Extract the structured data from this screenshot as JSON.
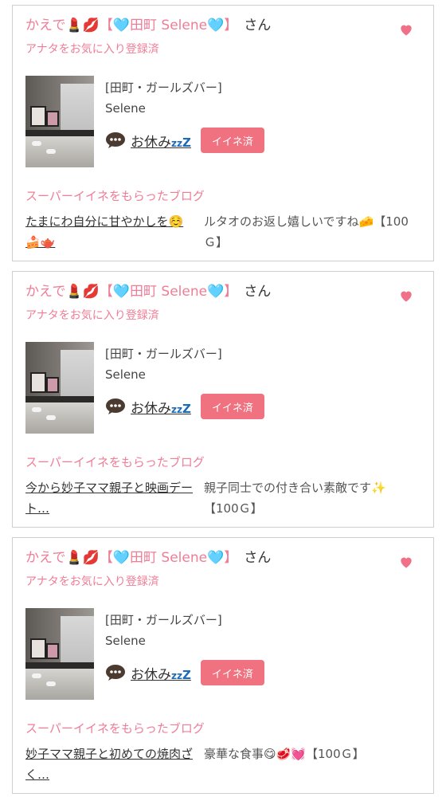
{
  "colors": {
    "accent_pink": "#ef7d96",
    "button_pink": "#f0717f",
    "zzz_blue": "#1c6bb8"
  },
  "cards": [
    {
      "user_prefix": "かえで💄💋",
      "user_tag": "【🩵田町 Selene🩵】",
      "user_suffix": "さん",
      "favorite_status": "アナタをお気に入り登録済",
      "shop": "[田町・ガールズバー]",
      "cast": "Selene",
      "status_text": "お休み",
      "zzz": [
        "z",
        "z",
        "Z"
      ],
      "like_label": "イイネ済",
      "section_label": "スーパーイイネをもらったブログ",
      "blog_title": "たまにわ自分に甘やかしを☺️🍰🫖",
      "comment": "ルタオのお返し嬉しいですね🧀【100Ｇ】"
    },
    {
      "user_prefix": "かえで💄💋",
      "user_tag": "【🩵田町 Selene🩵】",
      "user_suffix": "さん",
      "favorite_status": "アナタをお気に入り登録済",
      "shop": "[田町・ガールズバー]",
      "cast": "Selene",
      "status_text": "お休み",
      "zzz": [
        "z",
        "z",
        "Z"
      ],
      "like_label": "イイネ済",
      "section_label": "スーパーイイネをもらったブログ",
      "blog_title": "今から妙子ママ親子と映画デート…",
      "comment": "親子同士での付き合い素敵です✨【100Ｇ】"
    },
    {
      "user_prefix": "かえで💄💋",
      "user_tag": "【🩵田町 Selene🩵】",
      "user_suffix": "さん",
      "favorite_status": "アナタをお気に入り登録済",
      "shop": "[田町・ガールズバー]",
      "cast": "Selene",
      "status_text": "お休み",
      "zzz": [
        "z",
        "z",
        "Z"
      ],
      "like_label": "イイネ済",
      "section_label": "スーパーイイネをもらったブログ",
      "blog_title": "妙子ママ親子と初めての焼肉ざく…",
      "comment": "豪華な食事😋🥩💓【100Ｇ】"
    }
  ]
}
